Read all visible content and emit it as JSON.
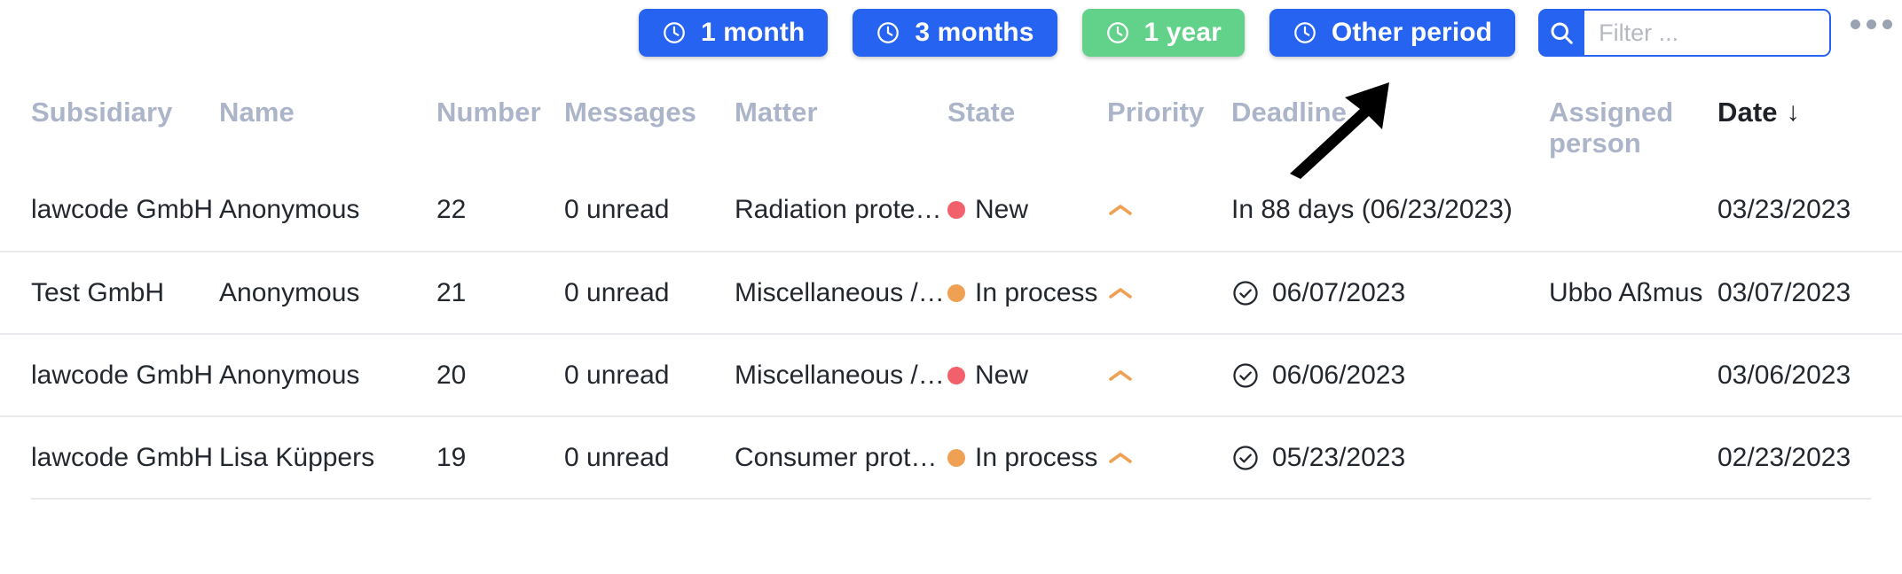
{
  "toolbar": {
    "period_buttons": [
      {
        "label": "1 month",
        "icon": "clock-icon",
        "color": "#2663f0",
        "active": false
      },
      {
        "label": "3 months",
        "icon": "clock-icon",
        "color": "#2663f0",
        "active": false
      },
      {
        "label": "1 year",
        "icon": "clock-icon",
        "color": "#62d189",
        "active": true
      },
      {
        "label": "Other period",
        "icon": "clock-icon",
        "color": "#2663f0",
        "active": false,
        "highlighted": true
      }
    ],
    "search": {
      "icon": "search-icon",
      "value": "",
      "placeholder": "Filter ..."
    },
    "more_menu": {
      "icon": "ellipsis-icon",
      "label": ""
    }
  },
  "annotation": {
    "type": "arrow",
    "points_to": "Other period",
    "color": "#000000"
  },
  "table": {
    "columns": [
      {
        "key": "subsidiary",
        "label": "Subsidiary",
        "sorted": false
      },
      {
        "key": "name",
        "label": "Name",
        "sorted": false
      },
      {
        "key": "number",
        "label": "Number",
        "sorted": false
      },
      {
        "key": "messages",
        "label": "Messages",
        "sorted": false
      },
      {
        "key": "matter",
        "label": "Matter",
        "sorted": false
      },
      {
        "key": "state",
        "label": "State",
        "sorted": false
      },
      {
        "key": "priority",
        "label": "Priority",
        "sorted": false
      },
      {
        "key": "deadline",
        "label": "Deadline",
        "sorted": false
      },
      {
        "key": "assigned_person",
        "label": "Assigned person",
        "sorted": false
      },
      {
        "key": "date",
        "label": "Date",
        "sorted": true,
        "sort_arrow": "↓"
      }
    ],
    "rows": [
      {
        "subsidiary": "lawcode GmbH",
        "name": "Anonymous",
        "number": "22",
        "messages": "0 unread",
        "matter": "Radiation prote…",
        "state": "New",
        "state_color": "#f2616b",
        "priority_icon": "chevron-up-icon",
        "priority_color": "#f0a053",
        "deadline": "In 88 days (06/23/2023)",
        "deadline_icon": "",
        "assigned_person": "",
        "date": "03/23/2023"
      },
      {
        "subsidiary": "Test GmbH",
        "name": "Anonymous",
        "number": "21",
        "messages": "0 unread",
        "matter": "Miscellaneous /…",
        "state": "In process",
        "state_color": "#f0a053",
        "priority_icon": "chevron-up-icon",
        "priority_color": "#f0a053",
        "deadline": "06/07/2023",
        "deadline_icon": "check-circle-icon",
        "assigned_person": "Ubbo Aßmus",
        "date": "03/07/2023"
      },
      {
        "subsidiary": "lawcode GmbH",
        "name": "Anonymous",
        "number": "20",
        "messages": "0 unread",
        "matter": "Miscellaneous /…",
        "state": "New",
        "state_color": "#f2616b",
        "priority_icon": "chevron-up-icon",
        "priority_color": "#f0a053",
        "deadline": "06/06/2023",
        "deadline_icon": "check-circle-icon",
        "assigned_person": "",
        "date": "03/06/2023"
      },
      {
        "subsidiary": "lawcode GmbH",
        "name": "Lisa Küppers",
        "number": "19",
        "messages": "0 unread",
        "matter": "Consumer prot…",
        "state": "In process",
        "state_color": "#f0a053",
        "priority_icon": "chevron-up-icon",
        "priority_color": "#f0a053",
        "deadline": "05/23/2023",
        "deadline_icon": "check-circle-icon",
        "assigned_person": "",
        "date": "02/23/2023"
      }
    ]
  },
  "colors": {
    "primary": "#2663f0",
    "success": "#62d189",
    "danger": "#f2616b",
    "warning": "#f0a053",
    "header_text": "#abb4c9",
    "body_text": "#23272e",
    "divider": "#e9eaee"
  }
}
